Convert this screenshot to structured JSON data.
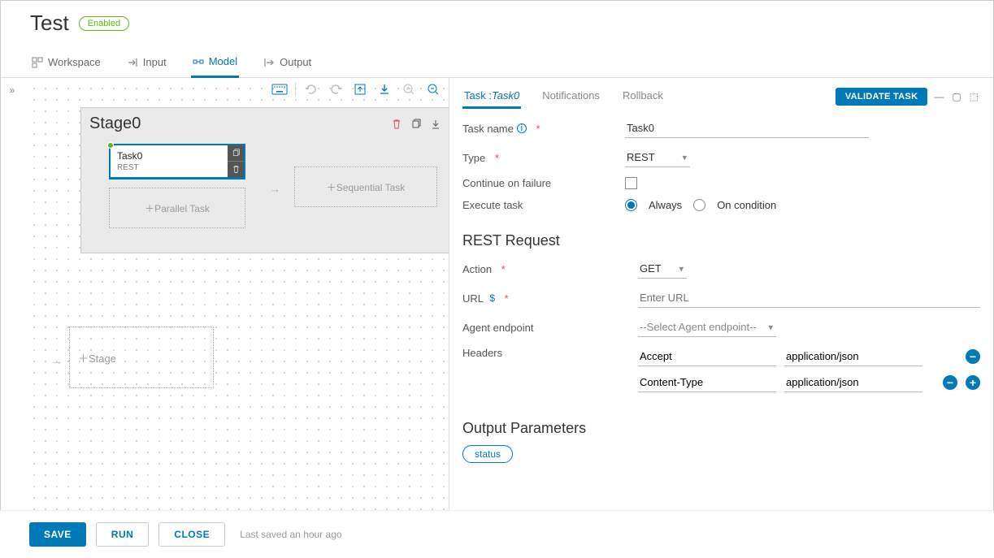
{
  "header": {
    "title": "Test",
    "status_badge": "Enabled"
  },
  "nav_tabs": {
    "workspace": "Workspace",
    "input": "Input",
    "model": "Model",
    "output": "Output"
  },
  "canvas": {
    "stage_title": "Stage0",
    "task": {
      "name": "Task0",
      "type": "REST"
    },
    "parallel_placeholder": "＋Parallel Task",
    "sequential_placeholder": "＋Sequential Task",
    "add_stage_placeholder": "＋Stage"
  },
  "details": {
    "tabs": {
      "task_prefix": "Task :",
      "task_name": "Task0",
      "notifications": "Notifications",
      "rollback": "Rollback"
    },
    "validate_label": "VALIDATE TASK",
    "fields": {
      "task_name_label": "Task name",
      "task_name_value": "Task0",
      "type_label": "Type",
      "type_value": "REST",
      "continue_label": "Continue on failure",
      "execute_label": "Execute task",
      "execute_options": {
        "always": "Always",
        "on_condition": "On condition"
      }
    },
    "rest": {
      "section": "REST Request",
      "action_label": "Action",
      "action_value": "GET",
      "url_label": "URL",
      "url_placeholder": "Enter URL",
      "agent_label": "Agent endpoint",
      "agent_placeholder": "--Select Agent endpoint--",
      "headers_label": "Headers",
      "headers": [
        {
          "key": "Accept",
          "value": "application/json"
        },
        {
          "key": "Content-Type",
          "value": "application/json"
        }
      ]
    },
    "output": {
      "section": "Output Parameters",
      "chip": "status"
    }
  },
  "footer": {
    "save": "SAVE",
    "run": "RUN",
    "close": "CLOSE",
    "last_saved": "Last saved an hour ago"
  }
}
